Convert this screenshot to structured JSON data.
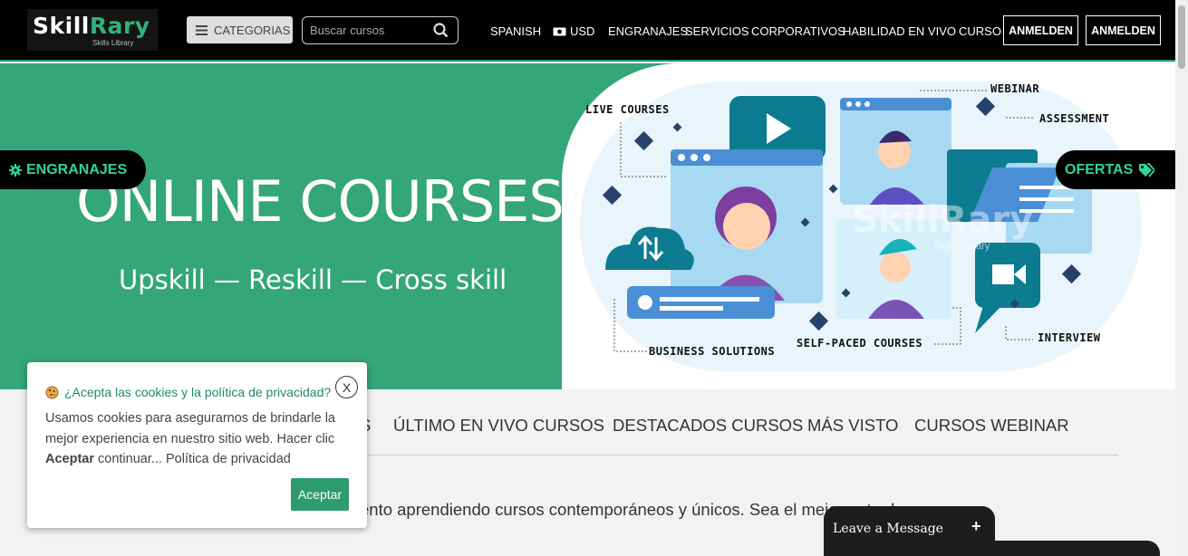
{
  "header": {
    "logo_main": "Skill",
    "logo_accent": "Rary",
    "logo_sub": "Skills Library",
    "categories_label": "CATEGORIAS",
    "search_placeholder": "Buscar cursos",
    "nav": {
      "language": "SPANISH",
      "currency": "USD",
      "engranajes": "ENGRANAJES",
      "servicios": "SERVICIOS",
      "corporativos": "CORPORATIVOS",
      "habilidad": "HABILIDAD EN VIVO",
      "curso": "CURSO"
    },
    "login_label": "ANMELDEN",
    "signup_label": "ANMELDEN"
  },
  "hero": {
    "title": "ONLINE COURSES",
    "subtitle": "Upskill — Reskill — Cross skill",
    "labels": {
      "live": "LIVE COURSES",
      "webinar": "WEBINAR",
      "assessment": "ASSESSMENT",
      "business": "BUSINESS SOLUTIONS",
      "selfpaced": "SELF-PACED COURSES",
      "interview": "INTERVIEW"
    },
    "watermark": "SkillRary",
    "watermark_sub": "Skills Library",
    "left_pill": "ENGRANAJES",
    "right_pill": "OFERTAS"
  },
  "tabs": [
    "S",
    "ÚLTIMO EN VIVO CURSOS",
    "DESTACADOS CURSOS",
    "MÁS VISTO",
    "CURSOS WEBINAR"
  ],
  "intro_text": "ento aprendiendo cursos contemporáneos y únicos. Sea el mejor entre lo",
  "cookie": {
    "title": "¿Acepta las cookies y la política de privacidad?",
    "close": "X",
    "body_1": "Usamos cookies para asegurarnos de brindarle la mejor experiencia en nuestro sitio web. Hacer clic ",
    "body_bold": "Aceptar",
    "body_2": " continuar... Política de privacidad",
    "accept": "Aceptar"
  },
  "chat": {
    "label": "Leave a Message",
    "plus": "+"
  },
  "colors": {
    "brand_green": "#34a679",
    "accent_green": "#2fd59a",
    "header_bg": "#000000"
  }
}
